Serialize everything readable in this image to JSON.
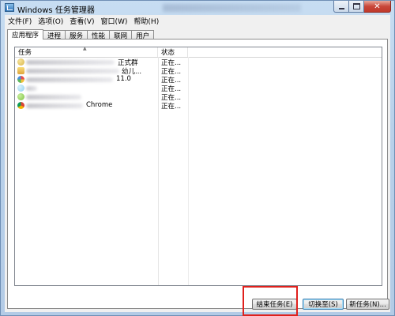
{
  "window": {
    "title": "Windows 任务管理器",
    "buttons": {
      "minimize": "minimize",
      "maximize": "maximize",
      "close": "✕"
    }
  },
  "menu": [
    {
      "label": "文件(F)"
    },
    {
      "label": "选项(O)"
    },
    {
      "label": "查看(V)"
    },
    {
      "label": "窗口(W)"
    },
    {
      "label": "帮助(H)"
    }
  ],
  "tabs": [
    {
      "label": "应用程序",
      "active": true
    },
    {
      "label": "进程"
    },
    {
      "label": "服务"
    },
    {
      "label": "性能"
    },
    {
      "label": "联网"
    },
    {
      "label": "用户"
    }
  ],
  "list": {
    "columns": {
      "task": "任务",
      "status": "状态"
    },
    "rows": [
      {
        "text": "正式群",
        "status": "正在...",
        "icon_color": "#d9b64a"
      },
      {
        "text": "幼儿...",
        "status": "正在...",
        "icon_color": "#e8c34f"
      },
      {
        "text": "11.0",
        "status": "正在...",
        "icon_color": "#5aa9e6"
      },
      {
        "text": "",
        "status": "正在...",
        "icon_color": "#8fd0f0"
      },
      {
        "text": "",
        "status": "正在...",
        "icon_color": "#7cc242"
      },
      {
        "text": "Chrome",
        "status": "正在...",
        "icon_color": "#4c8bf5"
      }
    ]
  },
  "actions": {
    "end_task": "结束任务(E)",
    "switch_to": "切换至(S)",
    "new_task": "新任务(N)..."
  }
}
